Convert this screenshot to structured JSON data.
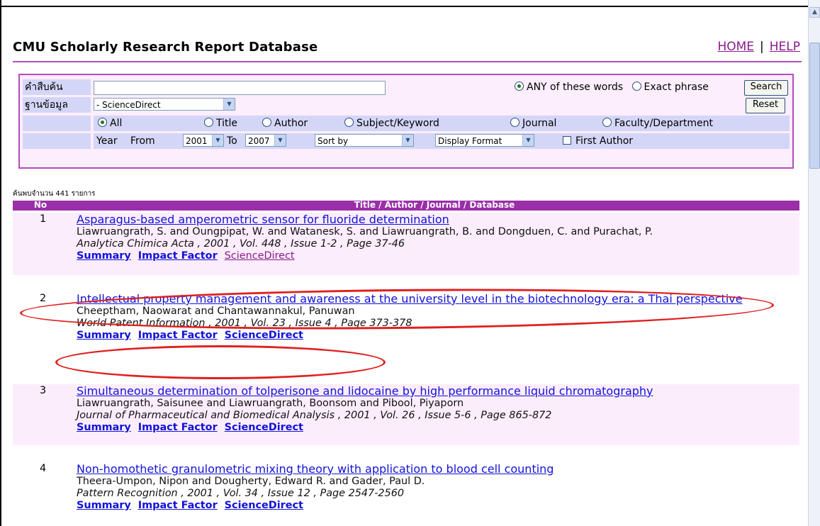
{
  "page": {
    "title": "CMU Scholarly Research Report Database",
    "links": {
      "home": "HOME",
      "separator": "|",
      "help": "HELP"
    }
  },
  "search": {
    "keyword_label": "คำสืบค้น",
    "keyword_value": "",
    "mode_any": "ANY of these words",
    "mode_exact": "Exact phrase",
    "search_button": "Search",
    "database_label": "ฐานข้อมูล",
    "database_value": "- ScienceDirect",
    "reset_button": "Reset",
    "fields": [
      "All",
      "Title",
      "Author",
      "Subject/Keyword",
      "Journal",
      "Faculty/Department"
    ],
    "selected_field": "All",
    "year_label": "Year",
    "from_label": "From",
    "year_from": "2001",
    "to_label": "To",
    "year_to": "2007",
    "sort_by": "Sort by",
    "display_format": "Display Format",
    "first_author": "First Author"
  },
  "results": {
    "count_text": "ค้นพบจำนวน 441 รายการ",
    "col_no": "No",
    "col_title": "Title / Author / Journal / Database",
    "items": [
      {
        "no": "1",
        "title": "Asparagus-based amperometric sensor for fluoride determination",
        "authors": "Liawruangrath, S. and Oungpipat, W. and Watanesk, S. and Liawruangrath, B. and Dongduen, C. and Purachat, P.",
        "journal": "Analytica Chimica Acta , 2001 , Vol. 448 , Issue 1-2 , Page 37-46",
        "links": [
          "Summary",
          "Impact Factor",
          "ScienceDirect"
        ]
      },
      {
        "no": "2",
        "title": "Intellectual property management and awareness at the university level in the biotechnology era: a Thai perspective",
        "authors": "Cheeptham, Naowarat and Chantawannakul, Panuwan",
        "journal": "World Patent Information , 2001 , Vol. 23 , Issue 4 , Page 373-378",
        "links": [
          "Summary",
          "Impact Factor",
          "ScienceDirect"
        ]
      },
      {
        "no": "3",
        "title": "Simultaneous determination of tolperisone and lidocaine by high performance liquid chromatography",
        "authors": "Liawruangrath, Saisunee and Liawruangrath, Boonsom and Pibool, Piyaporn",
        "journal": "Journal of Pharmaceutical and Biomedical Analysis , 2001 , Vol. 26 , Issue 5-6 , Page 865-872",
        "links": [
          "Summary",
          "Impact Factor",
          "ScienceDirect"
        ]
      },
      {
        "no": "4",
        "title": "Non-homothetic granulometric mixing theory with application to blood cell counting",
        "authors": "Theera-Umpon, Nipon and Dougherty, Edward R. and Gader, Paul D.",
        "journal": "Pattern Recognition , 2001 , Vol. 34 , Issue 12 , Page 2547-2560",
        "links": [
          "Summary",
          "Impact Factor",
          "ScienceDirect"
        ]
      }
    ]
  },
  "colors": {
    "accent": "#9a2fa8",
    "link": "#1212d8",
    "annotation": "#e02020"
  }
}
